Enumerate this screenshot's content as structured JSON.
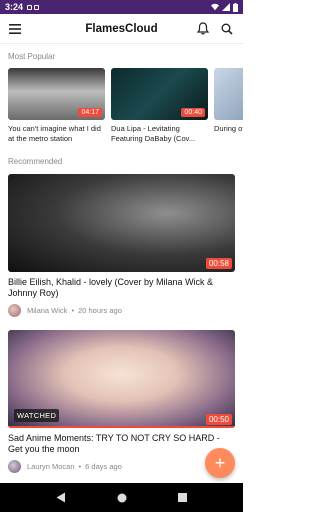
{
  "status_bar": {
    "time": "3:24"
  },
  "app_bar": {
    "title": "FlamesCloud"
  },
  "sections": {
    "popular_title": "Most Popular",
    "recommended_title": "Recommended"
  },
  "popular": [
    {
      "duration": "04:17",
      "title": "You can't imagine what I did at the metro station"
    },
    {
      "duration": "00:40",
      "title": "Dua Lipa - Levitating Featuring DaBaby (Cov..."
    },
    {
      "duration": "",
      "title": "During of the S..."
    }
  ],
  "recommended": [
    {
      "duration": "00:58",
      "title": "Billie Eilish, Khalid - lovely (Cover by Milana Wick & Johnny Roy)",
      "author": "Milana Wick",
      "time": "20 hours ago",
      "watched": "",
      "progress": 0
    },
    {
      "duration": "00:50",
      "title": "Sad Anime Moments: TRY TO NOT CRY SO HARD - Get you the moon",
      "author": "Lauryn Mocan",
      "time": "6 days ago",
      "watched": "WATCHED",
      "progress": 1.0
    }
  ],
  "fab": {
    "label": "+"
  },
  "colors": {
    "status_bar": "#4a2470",
    "accent": "#ee4b3a",
    "fab": "#ff8a5c"
  },
  "icons": {
    "menu": "hamburger-icon",
    "notifications": "bell-icon",
    "search": "search-icon",
    "back": "back-triangle-icon",
    "home": "home-circle-icon",
    "recents": "recents-square-icon"
  }
}
